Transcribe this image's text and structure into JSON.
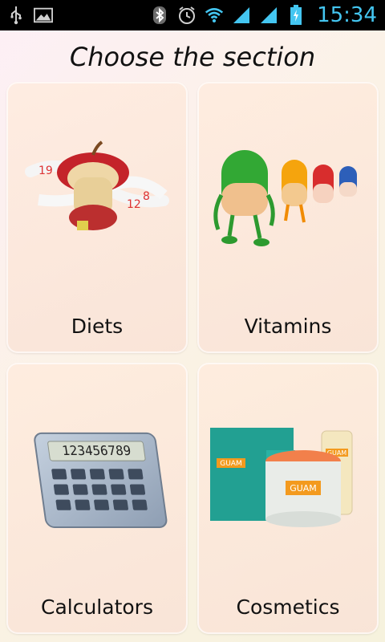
{
  "status_bar": {
    "left_icons": [
      "usb-icon",
      "image-icon"
    ],
    "right_icons": [
      "bluetooth-icon",
      "alarm-icon",
      "wifi-icon",
      "signal-icon",
      "signal-icon",
      "battery-charging-icon"
    ],
    "time": "15:34",
    "time_color": "#44c6f1"
  },
  "header": {
    "title": "Choose the section"
  },
  "tiles": [
    {
      "label": "Diets",
      "icon": "apple-tape-icon"
    },
    {
      "label": "Vitamins",
      "icon": "pills-icon"
    },
    {
      "label": "Calculators",
      "icon": "calculator-icon"
    },
    {
      "label": "Cosmetics",
      "icon": "cosmetics-products-icon"
    }
  ],
  "calculator_display": "123456789",
  "cosmetics_brand": "GUAM"
}
